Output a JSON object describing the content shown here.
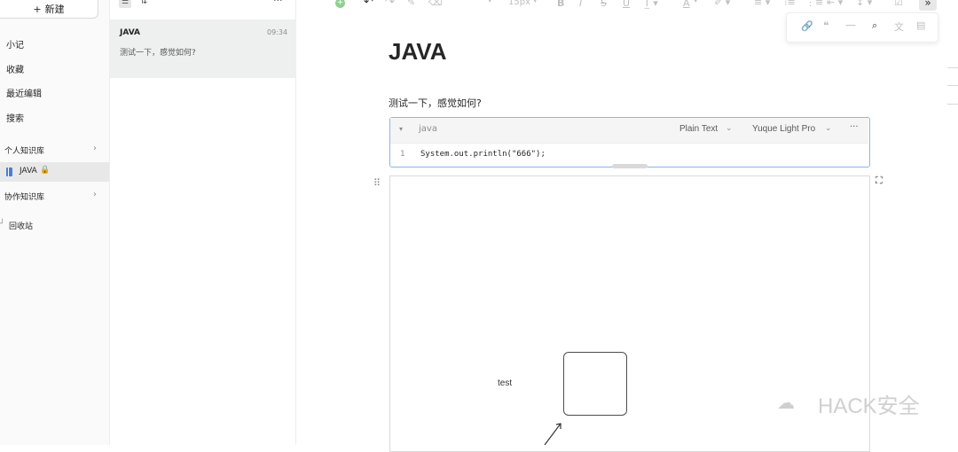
{
  "sidebar": {
    "new_label": "新建",
    "items": [
      {
        "label": "小记"
      },
      {
        "label": "收藏"
      },
      {
        "label": "最近编辑"
      },
      {
        "label": "搜索"
      }
    ],
    "personal_lib": "个人知识库",
    "java_book": "JAVA",
    "collab_lib": "协作知识库",
    "trash": "回收站"
  },
  "doc_list": {
    "item": {
      "title": "JAVA",
      "time": "09:34",
      "snippet": "测试一下，感觉如何?"
    }
  },
  "toolbar": {
    "font_size": "15px",
    "bold": "B",
    "italic": "I",
    "strike": "S",
    "underline": "U",
    "font_color": "A"
  },
  "editor": {
    "title": "JAVA",
    "paragraph": "测试一下，感觉如何?",
    "code": {
      "language": "java",
      "mode": "Plain Text",
      "theme": "Yuque Light Pro",
      "more": "···",
      "line_no": "1",
      "line": "System.out.println(\"666\");"
    },
    "drawing_label": "test"
  },
  "watermark": "HACK安全"
}
